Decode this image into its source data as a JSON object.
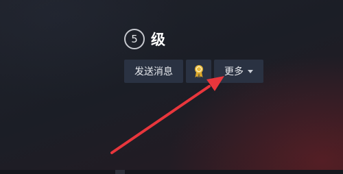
{
  "profile": {
    "level_number": "5",
    "level_label": "级"
  },
  "actions": {
    "send_message_label": "发送消息",
    "badge_icon": "award-ribbon-icon",
    "more_label": "更多",
    "more_icon": "caret-down-icon"
  },
  "annotation": {
    "arrow_color": "#e8363c",
    "arrow_icon": "red-pointer-arrow"
  },
  "colors": {
    "button_bg": "#2a3242",
    "badge_gold": "#e2b33a"
  }
}
